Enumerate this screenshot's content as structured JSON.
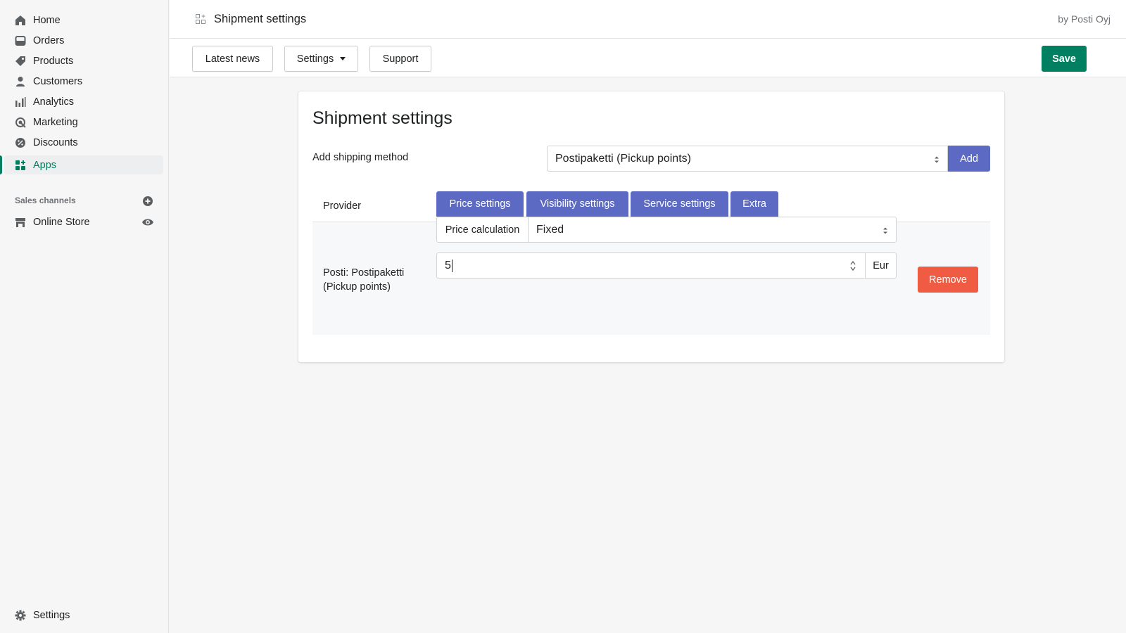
{
  "sidebar": {
    "items": [
      {
        "label": "Home",
        "icon": "home-icon"
      },
      {
        "label": "Orders",
        "icon": "orders-icon"
      },
      {
        "label": "Products",
        "icon": "tag-icon"
      },
      {
        "label": "Customers",
        "icon": "person-icon"
      },
      {
        "label": "Analytics",
        "icon": "bar-chart-icon"
      },
      {
        "label": "Marketing",
        "icon": "target-icon"
      },
      {
        "label": "Discounts",
        "icon": "discount-icon"
      },
      {
        "label": "Apps",
        "icon": "apps-icon",
        "active": true
      }
    ],
    "sales_channels_heading": "Sales channels",
    "online_store_label": "Online Store",
    "settings_label": "Settings"
  },
  "topbar": {
    "title": "Shipment settings",
    "byline": "by Posti Oyj"
  },
  "actionbar": {
    "latest_news": "Latest news",
    "settings": "Settings",
    "support": "Support",
    "save": "Save"
  },
  "card": {
    "title": "Shipment settings",
    "add_label": "Add shipping method",
    "method_selected": "Postipaketti (Pickup points)",
    "add_button": "Add",
    "provider_header": "Provider",
    "provider_name": "Posti: Postipaketti (Pickup points)",
    "tabs": [
      "Price settings",
      "Visibility settings",
      "Service settings",
      "Extra"
    ],
    "price_calc_label": "Price calculation",
    "price_calc_value": "Fixed",
    "price_value": "5",
    "price_unit": "Eur",
    "remove_button": "Remove"
  },
  "colors": {
    "accent_green": "#008060",
    "indigo": "#5c6ac4",
    "remove_red": "#f05c43"
  }
}
